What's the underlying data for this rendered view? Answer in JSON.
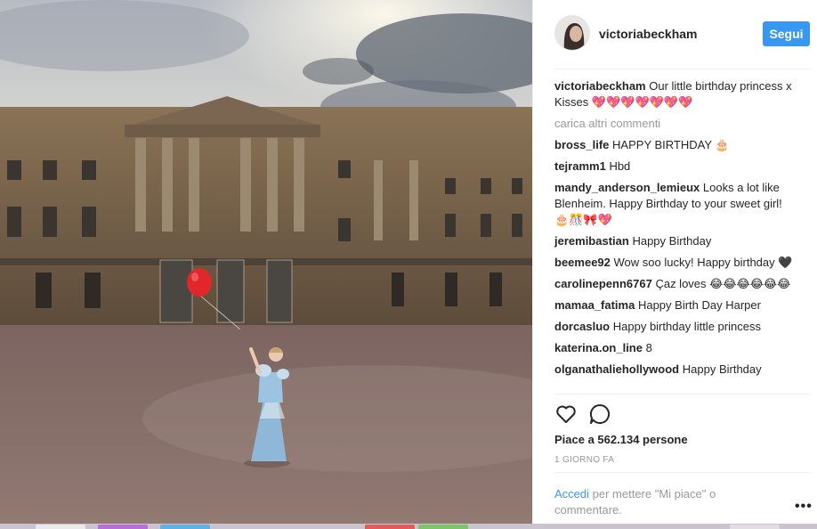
{
  "post": {
    "author": "victoriabeckham",
    "follow_label": "Segui",
    "caption_user": "victoriabeckham",
    "caption_text": "Our little birthday princess x Kisses 💖💖💖💖💖💖💖",
    "load_more": "carica altri commenti",
    "comments": [
      {
        "user": "bross_life",
        "text": "HAPPY BIRTHDAY 🎂"
      },
      {
        "user": "tejramm1",
        "text": "Hbd"
      },
      {
        "user": "mandy_anderson_lemieux",
        "text": "Looks a lot like Blenheim. Happy Birthday to your sweet girl! 🎂🎊🎀💖"
      },
      {
        "user": "jeremibastian",
        "text": "Happy Birthday"
      },
      {
        "user": "beemee92",
        "text": "Wow soo lucky! Happy birthday 🖤"
      },
      {
        "user": "carolinepenn6767",
        "text": "Çaz loves 😂😂😂😂😂😂"
      },
      {
        "user": "mamaa_fatima",
        "text": "Happy Birth Day Harper"
      },
      {
        "user": "dorcasluo",
        "text": "Happy birthday little princess"
      },
      {
        "user": "katerina.on_line",
        "text": "8"
      },
      {
        "user": "olganathaliehollywood",
        "text": "Happy Birthday"
      }
    ],
    "likes": "Piace a 562.134 persone",
    "time": "1 GIORNO FA",
    "login_link": "Accedi",
    "login_rest": " per mettere \"Mi piace\" o commentare.",
    "more": "•••"
  },
  "icons": {
    "like": "heart-icon",
    "comment": "comment-icon",
    "more": "more-options-icon"
  },
  "colors": {
    "accent": "#3897f0",
    "text": "#262626",
    "muted": "#999999",
    "balloon": "#e0282b",
    "dress": "#8fb8d8"
  }
}
